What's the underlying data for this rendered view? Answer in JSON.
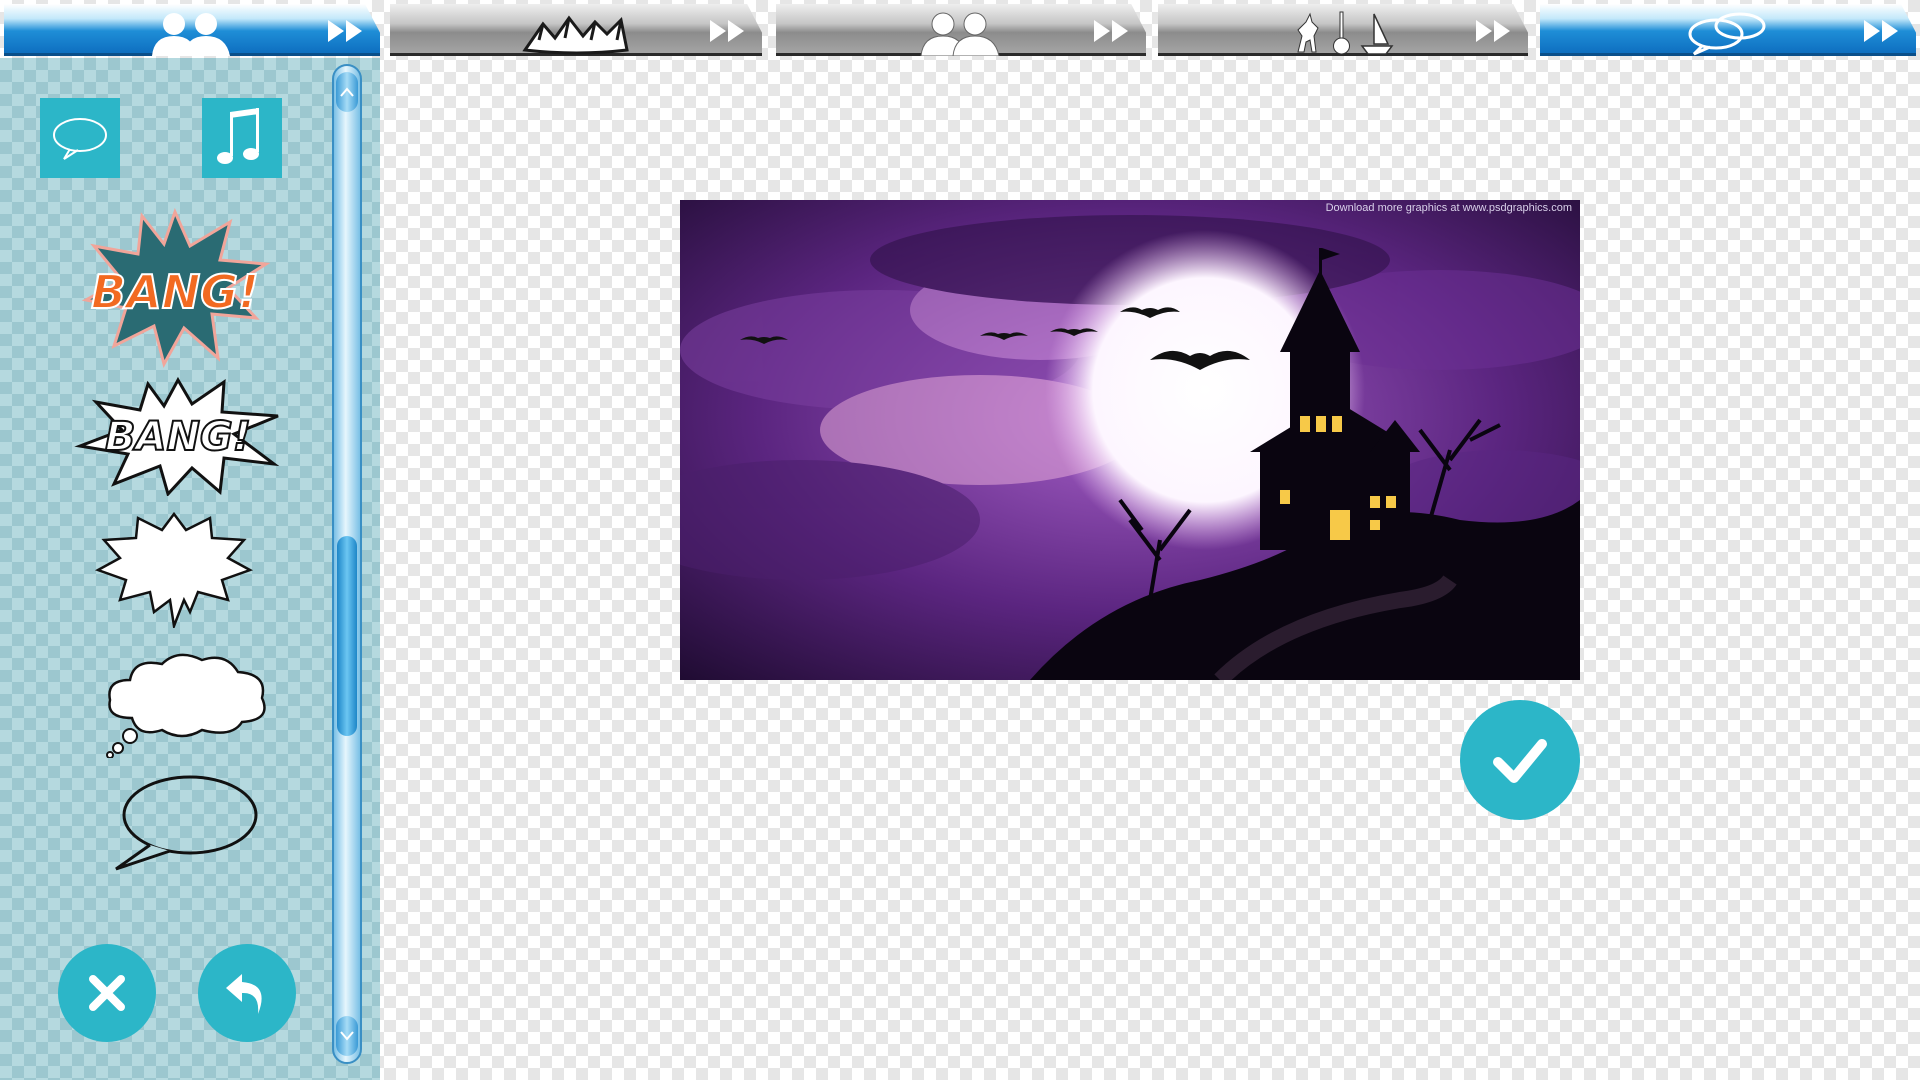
{
  "tabs": [
    {
      "name": "characters",
      "icon": "people-silhouette-icon",
      "active": true
    },
    {
      "name": "backgrounds",
      "icon": "mountains-icon",
      "active": false
    },
    {
      "name": "people",
      "icon": "people-silhouette-icon",
      "active": false
    },
    {
      "name": "objects",
      "icon": "unicorn-guitar-sailboat-icon",
      "active": false
    },
    {
      "name": "speech-bubbles",
      "icon": "speech-bubbles-icon",
      "active": true
    }
  ],
  "sidebar": {
    "categories": [
      {
        "name": "speech-bubble-category",
        "icon": "speech-bubble-icon"
      },
      {
        "name": "music-category",
        "icon": "music-note-icon"
      }
    ],
    "stickers": [
      {
        "name": "bang-orange-sticker",
        "text": "BANG!"
      },
      {
        "name": "bang-white-sticker",
        "text": "BANG!"
      },
      {
        "name": "shout-bubble-sticker"
      },
      {
        "name": "thought-bubble-sticker"
      },
      {
        "name": "speech-bubble-sticker"
      }
    ],
    "buttons": {
      "close": "close-icon",
      "undo": "undo-icon"
    }
  },
  "canvas": {
    "watermark": "Download more graphics at www.psdgraphics.com",
    "image": "haunted-house-night-scene"
  },
  "colors": {
    "accent": "#2cb6c8",
    "tab_blue": "#1f8ed7",
    "sidebar_bg": "#b5d9df"
  }
}
